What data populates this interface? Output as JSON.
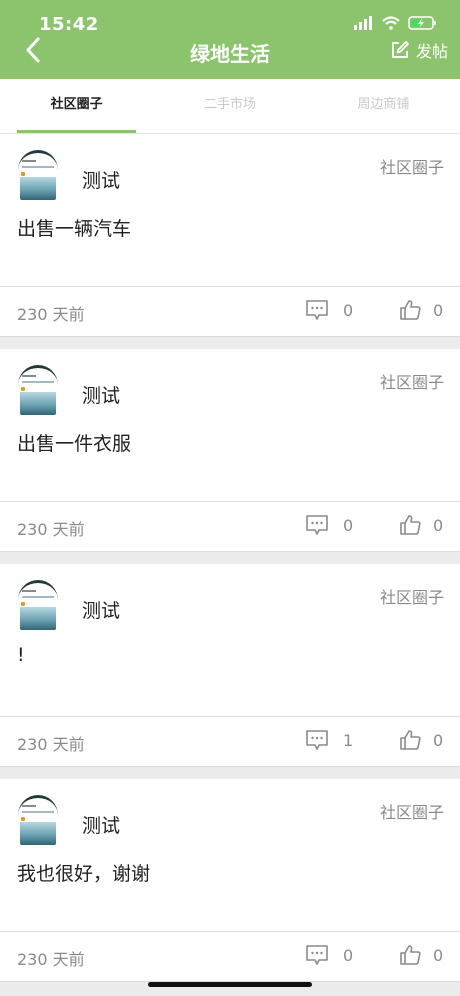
{
  "status_bar": {
    "time": "15:42"
  },
  "header": {
    "title": "绿地生活",
    "post_label": "发帖"
  },
  "tabs": [
    {
      "label": "社区圈子",
      "active": true
    },
    {
      "label": "二手市场",
      "active": false
    },
    {
      "label": "周边商铺",
      "active": false
    }
  ],
  "posts": [
    {
      "author": "测试",
      "category": "社区圈子",
      "content": "出售一辆汽车",
      "time": "230 天前",
      "comments": "0",
      "likes": "0"
    },
    {
      "author": "测试",
      "category": "社区圈子",
      "content": "出售一件衣服",
      "time": "230 天前",
      "comments": "0",
      "likes": "0"
    },
    {
      "author": "测试",
      "category": "社区圈子",
      "content": "!",
      "time": "230 天前",
      "comments": "1",
      "likes": "0"
    },
    {
      "author": "测试",
      "category": "社区圈子",
      "content": "我也很好，谢谢",
      "time": "230 天前",
      "comments": "0",
      "likes": "0"
    }
  ],
  "colors": {
    "header_bg": "#8cc46e",
    "accent": "#8cc46e",
    "muted_text": "#8a8a8a"
  }
}
